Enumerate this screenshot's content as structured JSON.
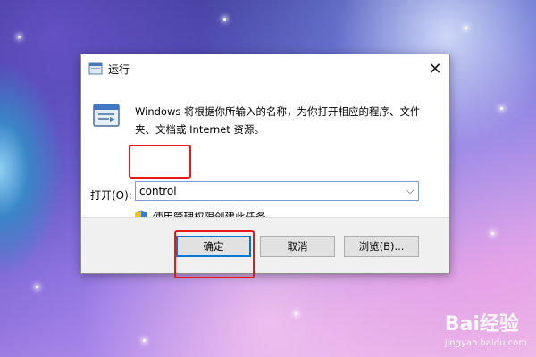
{
  "dialog": {
    "title": "运行",
    "description": "Windows 将根据你所输入的名称，为你打开相应的程序、文件夹、文档或 Internet 资源。",
    "open_label": "打开(O):",
    "input_value": "control",
    "admin_note": "使用管理权限创建此任务。",
    "buttons": {
      "ok": "确定",
      "cancel": "取消",
      "browse": "浏览(B)..."
    }
  },
  "watermark": {
    "brand": "Bai经验",
    "url": "jingyan.baidu.com"
  },
  "colors": {
    "highlight": "#e8171a",
    "accent": "#0078d7"
  },
  "icons": [
    "run-app-icon",
    "run-large-icon",
    "shield-icon",
    "close-icon",
    "chevron-down-icon",
    "baidu-paw-icon"
  ]
}
